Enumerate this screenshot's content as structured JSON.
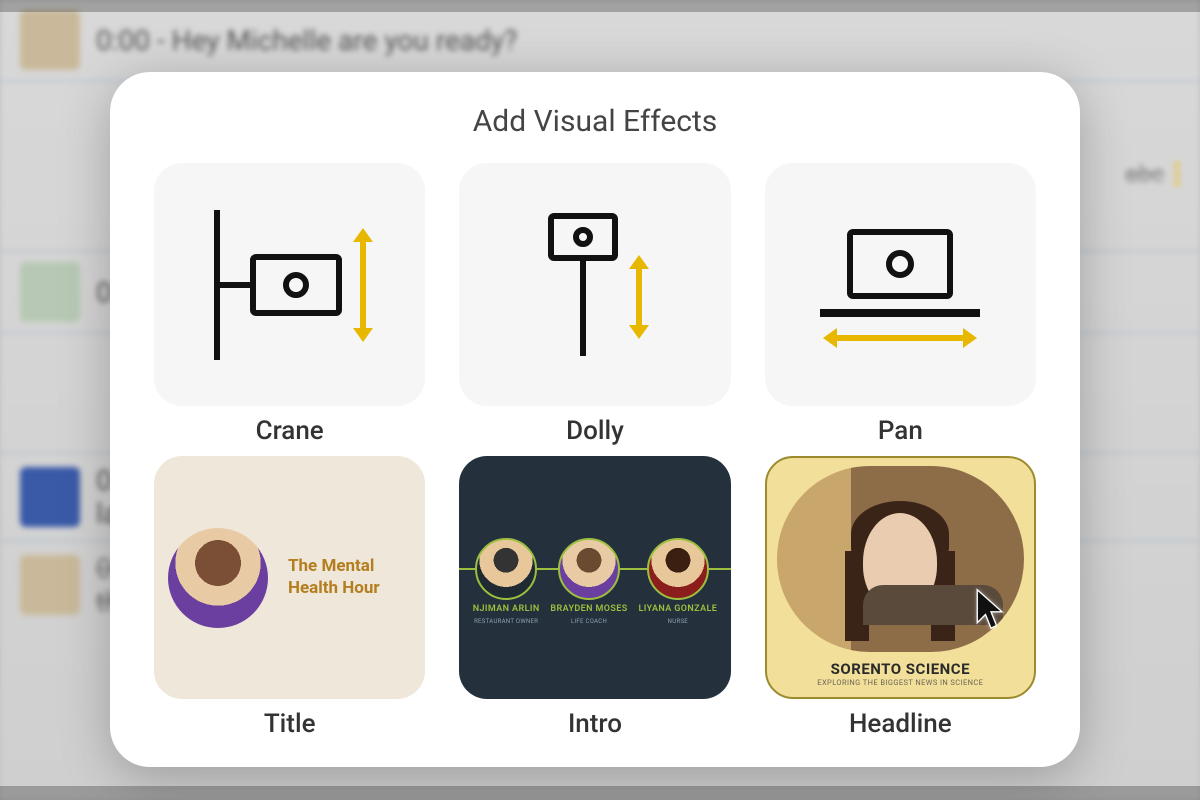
{
  "background": {
    "rows": [
      {
        "time": "0:00",
        "text": "Hey Michelle are you ready?"
      },
      {
        "time": "0:",
        "text": ""
      },
      {
        "time": "0:",
        "text": "la"
      },
      {
        "time": "0:",
        "text": "th",
        "struck": true
      }
    ],
    "topright_label": "abc"
  },
  "modal": {
    "title": "Add Visual Effects",
    "effects": [
      {
        "key": "crane",
        "label": "Crane"
      },
      {
        "key": "dolly",
        "label": "Dolly"
      },
      {
        "key": "pan",
        "label": "Pan"
      },
      {
        "key": "title",
        "label": "Title"
      },
      {
        "key": "intro",
        "label": "Intro"
      },
      {
        "key": "headline",
        "label": "Headline"
      }
    ],
    "title_card": {
      "heading": "The Mental Health Hour"
    },
    "intro_card": {
      "people": [
        {
          "name": "NJIMAN ARLIN",
          "role": "RESTAURANT OWNER"
        },
        {
          "name": "BRAYDEN MOSES",
          "role": "LIFE COACH"
        },
        {
          "name": "LIYANA GONZALE",
          "role": "NURSE"
        }
      ]
    },
    "headline_card": {
      "title": "SORENTO SCIENCE",
      "subtitle": "EXPLORING THE BIGGEST NEWS IN SCIENCE"
    }
  }
}
